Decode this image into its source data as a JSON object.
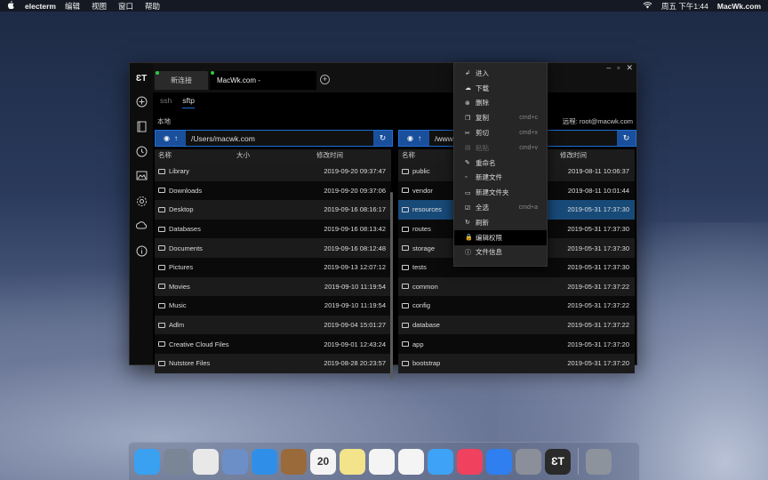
{
  "menubar": {
    "apple_icon": "apple-icon",
    "app_name": "electerm",
    "items": [
      "编辑",
      "视图",
      "窗口",
      "帮助"
    ],
    "clock": "周五 下午1:44",
    "site": "MacWk.com",
    "wifi_icon": "wifi-icon"
  },
  "window": {
    "logo": "ƐT",
    "tabs": [
      {
        "label": "新连接"
      },
      {
        "label": "MacWk.com - root@macwk.co..."
      }
    ],
    "subtabs": [
      "ssh",
      "sftp"
    ],
    "active_subtab": "sftp",
    "local_label": "本地",
    "remote_label": "远程: root@macwk.com",
    "local_path": "/Users/macwk.com",
    "remote_path": "/www/",
    "local_headers": [
      "名称",
      "大小",
      "修改时间"
    ],
    "remote_headers": [
      "名称",
      "修改时间"
    ],
    "local_files": [
      {
        "name": "Library",
        "date": "2019-09-20 09:37:47"
      },
      {
        "name": "Downloads",
        "date": "2019-09-20 09:37:06"
      },
      {
        "name": "Desktop",
        "date": "2019-09-16 08:16:17"
      },
      {
        "name": "Databases",
        "date": "2019-09-16 08:13:42"
      },
      {
        "name": "Documents",
        "date": "2019-09-16 08:12:48"
      },
      {
        "name": "Pictures",
        "date": "2019-09-13 12:07:12"
      },
      {
        "name": "Movies",
        "date": "2019-09-10 11:19:54"
      },
      {
        "name": "Music",
        "date": "2019-09-10 11:19:54"
      },
      {
        "name": "Adlm",
        "date": "2019-09-04 15:01:27"
      },
      {
        "name": "Creative Cloud Files",
        "date": "2019-09-01 12:43:24"
      },
      {
        "name": "Nutstore Files",
        "date": "2019-08-28 20:23:57"
      }
    ],
    "remote_files": [
      {
        "name": "public",
        "date": "2019-08-11 10:06:37"
      },
      {
        "name": "vendor",
        "date": "2019-08-11 10:01:44"
      },
      {
        "name": "resources",
        "date": "2019-05-31 17:37:30",
        "selected": true
      },
      {
        "name": "routes",
        "date": "2019-05-31 17:37:30"
      },
      {
        "name": "storage",
        "date": "2019-05-31 17:37:30"
      },
      {
        "name": "tests",
        "date": "2019-05-31 17:37:30"
      },
      {
        "name": "common",
        "date": "2019-05-31 17:37:22"
      },
      {
        "name": "config",
        "date": "2019-05-31 17:37:22"
      },
      {
        "name": "database",
        "date": "2019-05-31 17:37:22"
      },
      {
        "name": "app",
        "date": "2019-05-31 17:37:20"
      },
      {
        "name": "bootstrap",
        "date": "2019-05-31 17:37:20"
      }
    ]
  },
  "context_menu": [
    {
      "label": "进入",
      "icon": "enter-icon",
      "shortcut": ""
    },
    {
      "label": "下载",
      "icon": "download-icon",
      "shortcut": ""
    },
    {
      "label": "删除",
      "icon": "delete-icon",
      "shortcut": ""
    },
    {
      "label": "复制",
      "icon": "copy-icon",
      "shortcut": "cmd+c"
    },
    {
      "label": "剪切",
      "icon": "cut-icon",
      "shortcut": "cmd+x"
    },
    {
      "label": "粘贴",
      "icon": "paste-icon",
      "shortcut": "cmd+v",
      "disabled": true
    },
    {
      "label": "重命名",
      "icon": "edit-icon",
      "shortcut": ""
    },
    {
      "label": "新建文件",
      "icon": "new-file-icon",
      "shortcut": ""
    },
    {
      "label": "新建文件夹",
      "icon": "new-folder-icon",
      "shortcut": ""
    },
    {
      "label": "全选",
      "icon": "select-all-icon",
      "shortcut": "cmd+a"
    },
    {
      "label": "刷新",
      "icon": "refresh-icon",
      "shortcut": ""
    },
    {
      "label": "编辑权限",
      "icon": "lock-icon",
      "shortcut": "",
      "highlighted": true
    },
    {
      "label": "文件信息",
      "icon": "info-icon",
      "shortcut": ""
    }
  ],
  "dock": [
    {
      "name": "finder-icon",
      "color": "#3aa0f0"
    },
    {
      "name": "launchpad-icon",
      "color": "#7a8596"
    },
    {
      "name": "chrome-icon",
      "color": "#e8e8e8"
    },
    {
      "name": "mail-stamp-icon",
      "color": "#6c8fc7"
    },
    {
      "name": "safari-icon",
      "color": "#2f8fe8"
    },
    {
      "name": "notebook-icon",
      "color": "#9a6a3a"
    },
    {
      "name": "calendar-icon",
      "color": "#f4f4f4",
      "text": "20"
    },
    {
      "name": "notes-icon",
      "color": "#f3e38a"
    },
    {
      "name": "reminders-icon",
      "color": "#f4f4f4"
    },
    {
      "name": "photos-icon",
      "color": "#f4f4f4"
    },
    {
      "name": "messages-icon",
      "color": "#3ea2f7"
    },
    {
      "name": "music-icon",
      "color": "#f0415f"
    },
    {
      "name": "app-store-icon",
      "color": "#2f7ff0"
    },
    {
      "name": "system-preferences-icon",
      "color": "#8a8f99"
    },
    {
      "name": "electerm-icon",
      "color": "#2a2a2a",
      "text": "ƐT"
    },
    {
      "name": "trash-icon",
      "color": "#8d939c"
    }
  ]
}
